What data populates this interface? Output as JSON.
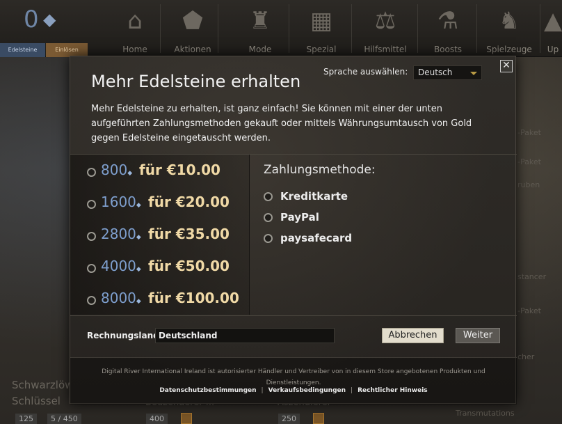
{
  "background": {
    "gem_count": "0",
    "tabs": [
      "Edelsteine",
      "Einlösen"
    ],
    "nav": [
      {
        "label": "Home",
        "icon": "house-icon"
      },
      {
        "label": "Aktionen",
        "icon": "tag-icon"
      },
      {
        "label": "Mode",
        "icon": "clothing-icon"
      },
      {
        "label": "Spezial",
        "icon": "crate-icon"
      },
      {
        "label": "Hilfsmittel",
        "icon": "scales-icon"
      },
      {
        "label": "Boosts",
        "icon": "potion-icon"
      },
      {
        "label": "Spielzeuge",
        "icon": "squirrel-icon"
      },
      {
        "label": "Up",
        "icon": "upgrade-icon"
      }
    ],
    "side_items": [
      "-Paket",
      "-Paket",
      "ruben",
      "stancer",
      "-Paket",
      "cher"
    ],
    "cards": [
      {
        "title_line1": "Schwarzlöw",
        "title_line2": "Schlüssel",
        "price1": "125",
        "price2": "5 / 450"
      },
      {
        "title_line1": "Beuzenaerer ...",
        "price1": "400"
      },
      {
        "title_line1": "Aszendierer",
        "price1": "250",
        "sub": "Transmutations"
      }
    ]
  },
  "modal": {
    "title": "Mehr Edelsteine erhalten",
    "language_label": "Sprache auswählen:",
    "language_value": "Deutsch",
    "close_glyph": "✕",
    "intro": "Mehr Edelsteine zu erhalten, ist ganz einfach! Sie können mit einer der unten aufgeführten Zahlungsmethoden gekauft oder mittels Währungsumtausch von Gold gegen Edelsteine eingetauscht werden.",
    "gem_symbol": "◆",
    "packages": [
      {
        "gems": "800",
        "price": "für €10.00"
      },
      {
        "gems": "1600",
        "price": "für €20.00"
      },
      {
        "gems": "2800",
        "price": "für €35.00"
      },
      {
        "gems": "4000",
        "price": "für €50.00"
      },
      {
        "gems": "8000",
        "price": "für €100.00"
      }
    ],
    "payment_title": "Zahlungsmethode:",
    "payment_methods": [
      "Kreditkarte",
      "PayPal",
      "paysafecard"
    ],
    "country_label": "Rechnungsland",
    "country_value": "Deutschland",
    "cancel_label": "Abbrechen",
    "next_label": "Weiter",
    "footer_text": "Digital River International Ireland ist autorisierter Händler und Vertreiber von in diesem Store angebotenen Produkten und Dienstleistungen.",
    "footer_links": [
      "Datenschutzbestimmungen",
      "Verkaufsbedingungen",
      "Rechtlicher Hinweis"
    ],
    "footer_sep": "|"
  }
}
